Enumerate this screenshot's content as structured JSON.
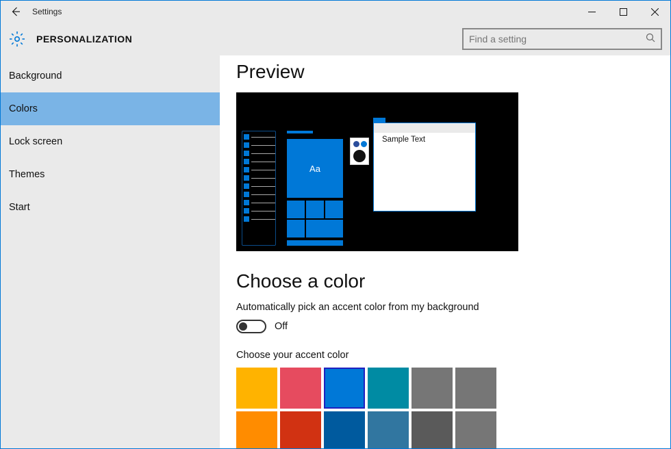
{
  "window": {
    "title": "Settings"
  },
  "header": {
    "page_title": "PERSONALIZATION",
    "search_placeholder": "Find a setting"
  },
  "sidebar": {
    "items": [
      {
        "label": "Background",
        "selected": false
      },
      {
        "label": "Colors",
        "selected": true
      },
      {
        "label": "Lock screen",
        "selected": false
      },
      {
        "label": "Themes",
        "selected": false
      },
      {
        "label": "Start",
        "selected": false
      }
    ]
  },
  "content": {
    "preview_heading": "Preview",
    "preview_tile_text": "Aa",
    "preview_sample_text": "Sample Text",
    "choose_color_heading": "Choose a color",
    "auto_pick_label": "Automatically pick an accent color from my background",
    "auto_pick_state": "Off",
    "accent_label": "Choose your accent color",
    "accent_colors_row1": [
      {
        "hex": "#ffb300",
        "selected": false
      },
      {
        "hex": "#e64b5f",
        "selected": false
      },
      {
        "hex": "#0078d7",
        "selected": true
      },
      {
        "hex": "#008ba3",
        "selected": false
      },
      {
        "hex": "#767676",
        "selected": false
      },
      {
        "hex": "#767676",
        "selected": false
      }
    ],
    "accent_colors_row2": [
      {
        "hex": "#ff8c00",
        "selected": false
      },
      {
        "hex": "#d13212",
        "selected": false
      },
      {
        "hex": "#005a9e",
        "selected": false
      },
      {
        "hex": "#3176a0",
        "selected": false
      },
      {
        "hex": "#5a5a5a",
        "selected": false
      },
      {
        "hex": "#767676",
        "selected": false
      }
    ]
  }
}
